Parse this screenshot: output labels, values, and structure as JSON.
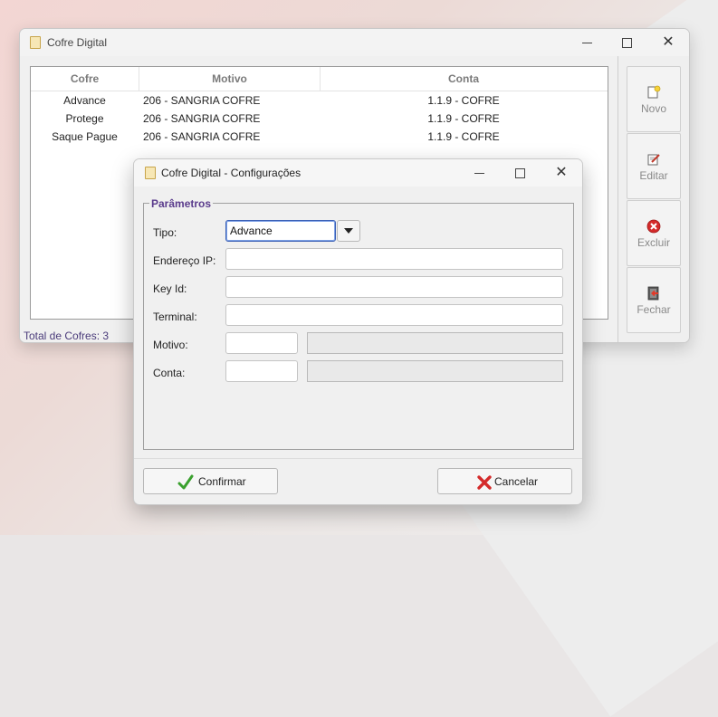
{
  "main_window": {
    "title": "Cofre Digital",
    "columns": [
      "Cofre",
      "Motivo",
      "Conta"
    ],
    "rows": [
      {
        "cofre": "Advance",
        "motivo": "206 - SANGRIA COFRE",
        "conta": "1.1.9 - COFRE"
      },
      {
        "cofre": "Protege",
        "motivo": "206 - SANGRIA COFRE",
        "conta": "1.1.9 - COFRE"
      },
      {
        "cofre": "Saque Pague",
        "motivo": "206 - SANGRIA COFRE",
        "conta": "1.1.9 - COFRE"
      }
    ],
    "status": "Total de Cofres: 3",
    "side_buttons": {
      "novo": "Novo",
      "editar": "Editar",
      "excluir": "Excluir",
      "fechar": "Fechar"
    }
  },
  "dialog": {
    "title": "Cofre Digital - Configurações",
    "group_title": "Parâmetros",
    "labels": {
      "tipo": "Tipo:",
      "endereco_ip": "Endereço IP:",
      "key_id": "Key Id:",
      "terminal": "Terminal:",
      "motivo": "Motivo:",
      "conta": "Conta:"
    },
    "values": {
      "tipo": "Advance",
      "endereco_ip": "",
      "key_id": "",
      "terminal": "",
      "motivo_code": "",
      "motivo_desc": "",
      "conta_code": "",
      "conta_desc": ""
    },
    "buttons": {
      "confirmar": "Confirmar",
      "cancelar": "Cancelar"
    }
  },
  "icons": {
    "app": "safe-icon",
    "novo": "new-document-icon",
    "editar": "edit-icon",
    "excluir": "delete-icon",
    "fechar": "exit-icon",
    "confirmar": "checkmark-icon",
    "cancelar": "x-icon"
  },
  "colors": {
    "accent_purple": "#5a3b8c",
    "delete_red": "#d42a2a",
    "confirm_green": "#3aa02e"
  }
}
